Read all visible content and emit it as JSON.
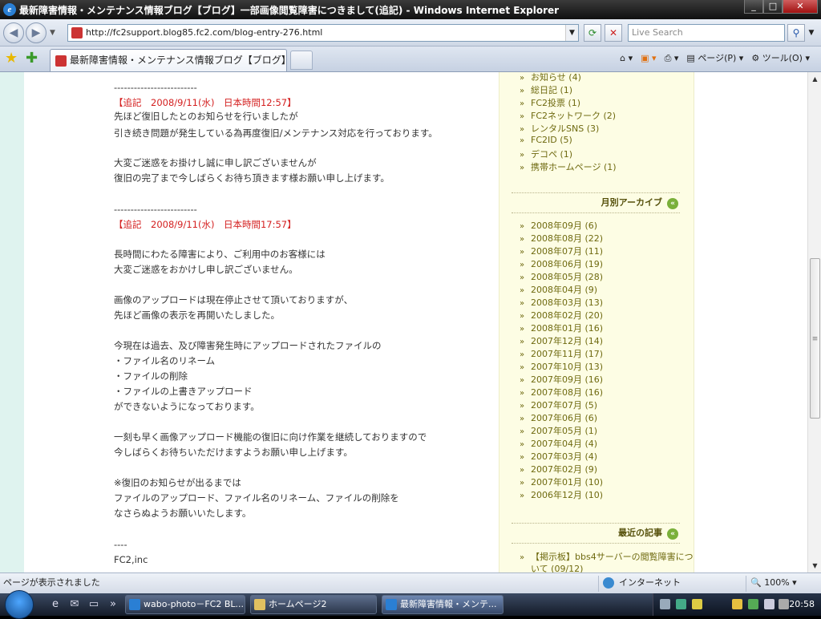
{
  "window": {
    "title": "最新障害情報・メンテナンス情報ブログ【ブログ】一部画像閲覧障害につきまして(追記) - Windows Internet Explorer",
    "buttons": [
      "_",
      "□",
      "✕"
    ]
  },
  "address_bar": {
    "url": "http://fc2support.blog85.fc2.com/blog-entry-276.html",
    "search_placeholder": "Live Search"
  },
  "tab": {
    "label": "最新障害情報・メンテナンス情報ブログ【ブログ】一部..."
  },
  "commands": {
    "page": "ページ(P)",
    "tools": "ツール(O)"
  },
  "article": {
    "lines": [
      {
        "text": "-------------------------",
        "style": "normal"
      },
      {
        "text": "【追記　2008/9/11(水)　日本時間12:57】",
        "style": "red"
      },
      {
        "text": "先ほど復旧したとのお知らせを行いましたが",
        "style": "normal"
      },
      {
        "text": "引き続き問題が発生している為再度復旧/メンテナンス対応を行っております。",
        "style": "normal"
      },
      {
        "text": "",
        "style": "normal"
      },
      {
        "text": "大変ご迷惑をお掛けし誠に申し訳ございませんが",
        "style": "normal"
      },
      {
        "text": "復旧の完了まで今しばらくお待ち頂きます様お願い申し上げます。",
        "style": "normal"
      },
      {
        "text": "",
        "style": "normal"
      },
      {
        "text": "-------------------------",
        "style": "normal"
      },
      {
        "text": "【追記　2008/9/11(水)　日本時間17:57】",
        "style": "red"
      },
      {
        "text": "",
        "style": "normal"
      },
      {
        "text": "長時間にわたる障害により、ご利用中のお客様には",
        "style": "normal"
      },
      {
        "text": "大変ご迷惑をおかけし申し訳ございません。",
        "style": "normal"
      },
      {
        "text": "",
        "style": "normal"
      },
      {
        "text": "画像のアップロードは現在停止させて頂いておりますが、",
        "style": "normal"
      },
      {
        "text": "先ほど画像の表示を再開いたしました。",
        "style": "normal"
      },
      {
        "text": "",
        "style": "normal"
      },
      {
        "text": "今現在は過去、及び障害発生時にアップロードされたファイルの",
        "style": "normal"
      },
      {
        "text": "・ファイル名のリネーム",
        "style": "normal"
      },
      {
        "text": "・ファイルの削除",
        "style": "normal"
      },
      {
        "text": "・ファイルの上書きアップロード",
        "style": "normal"
      },
      {
        "text": "ができないようになっております。",
        "style": "normal"
      },
      {
        "text": "",
        "style": "normal"
      },
      {
        "text": "一刻も早く画像アップロード機能の復旧に向け作業を継続しておりますので",
        "style": "normal"
      },
      {
        "text": "今しばらくお待ちいただけますようお願い申し上げます。",
        "style": "normal"
      },
      {
        "text": "",
        "style": "normal"
      },
      {
        "text": "※復旧のお知らせが出るまでは",
        "style": "normal"
      },
      {
        "text": "ファイルのアップロード、ファイル名のリネーム、ファイルの削除を",
        "style": "normal"
      },
      {
        "text": "なさらぬようお願いいたします。",
        "style": "normal"
      },
      {
        "text": "",
        "style": "normal"
      },
      {
        "text": "----",
        "style": "normal"
      },
      {
        "text": "FC2,inc",
        "style": "normal"
      }
    ]
  },
  "sidebar": {
    "categories": [
      "お知らせ (4)",
      "総日記 (1)",
      "FC2投票 (1)",
      "FC2ネットワーク (2)",
      "レンタルSNS (3)",
      "FC2ID (5)",
      "デコペ (1)",
      "携帯ホームページ (1)"
    ],
    "archive_heading": "月別アーカイブ",
    "archive": [
      "2008年09月 (6)",
      "2008年08月 (22)",
      "2008年07月 (11)",
      "2008年06月 (19)",
      "2008年05月 (28)",
      "2008年04月 (9)",
      "2008年03月 (13)",
      "2008年02月 (20)",
      "2008年01月 (16)",
      "2007年12月 (14)",
      "2007年11月 (17)",
      "2007年10月 (13)",
      "2007年09月 (16)",
      "2007年08月 (16)",
      "2007年07月 (5)",
      "2007年06月 (6)",
      "2007年05月 (1)",
      "2007年04月 (4)",
      "2007年03月 (4)",
      "2007年02月 (9)",
      "2007年01月 (10)",
      "2006年12月 (10)"
    ],
    "recent_heading": "最近の記事",
    "recent": [
      "【掲示板】bbs4サーバーの閲覧障害につ",
      "いて (09/12)"
    ]
  },
  "statusbar": {
    "message": "ページが表示されました",
    "zone": "インターネット",
    "zoom": "100%"
  },
  "taskbar": {
    "items": [
      {
        "label": "wabo-photo－FC2 BL...",
        "active": false
      },
      {
        "label": "ホームページ2",
        "active": false
      },
      {
        "label": "最新障害情報・メンテ...",
        "active": true
      }
    ],
    "clock": "20:58"
  },
  "icons": [
    "ie-icon",
    "back-icon",
    "forward-icon",
    "favicon",
    "refresh-icon",
    "stop-icon",
    "search-icon",
    "favorites-star-icon",
    "add-favorites-icon",
    "home-icon",
    "rss-icon",
    "print-icon",
    "page-icon",
    "tools-gear-icon",
    "globe-icon",
    "zoom-icon",
    "start-orb-icon"
  ],
  "colors": {
    "accent_red": "#d42020",
    "sidebar_bg": "#fdfde4",
    "sidebar_link": "#6f6a10",
    "left_strip": "#dff3ef"
  }
}
